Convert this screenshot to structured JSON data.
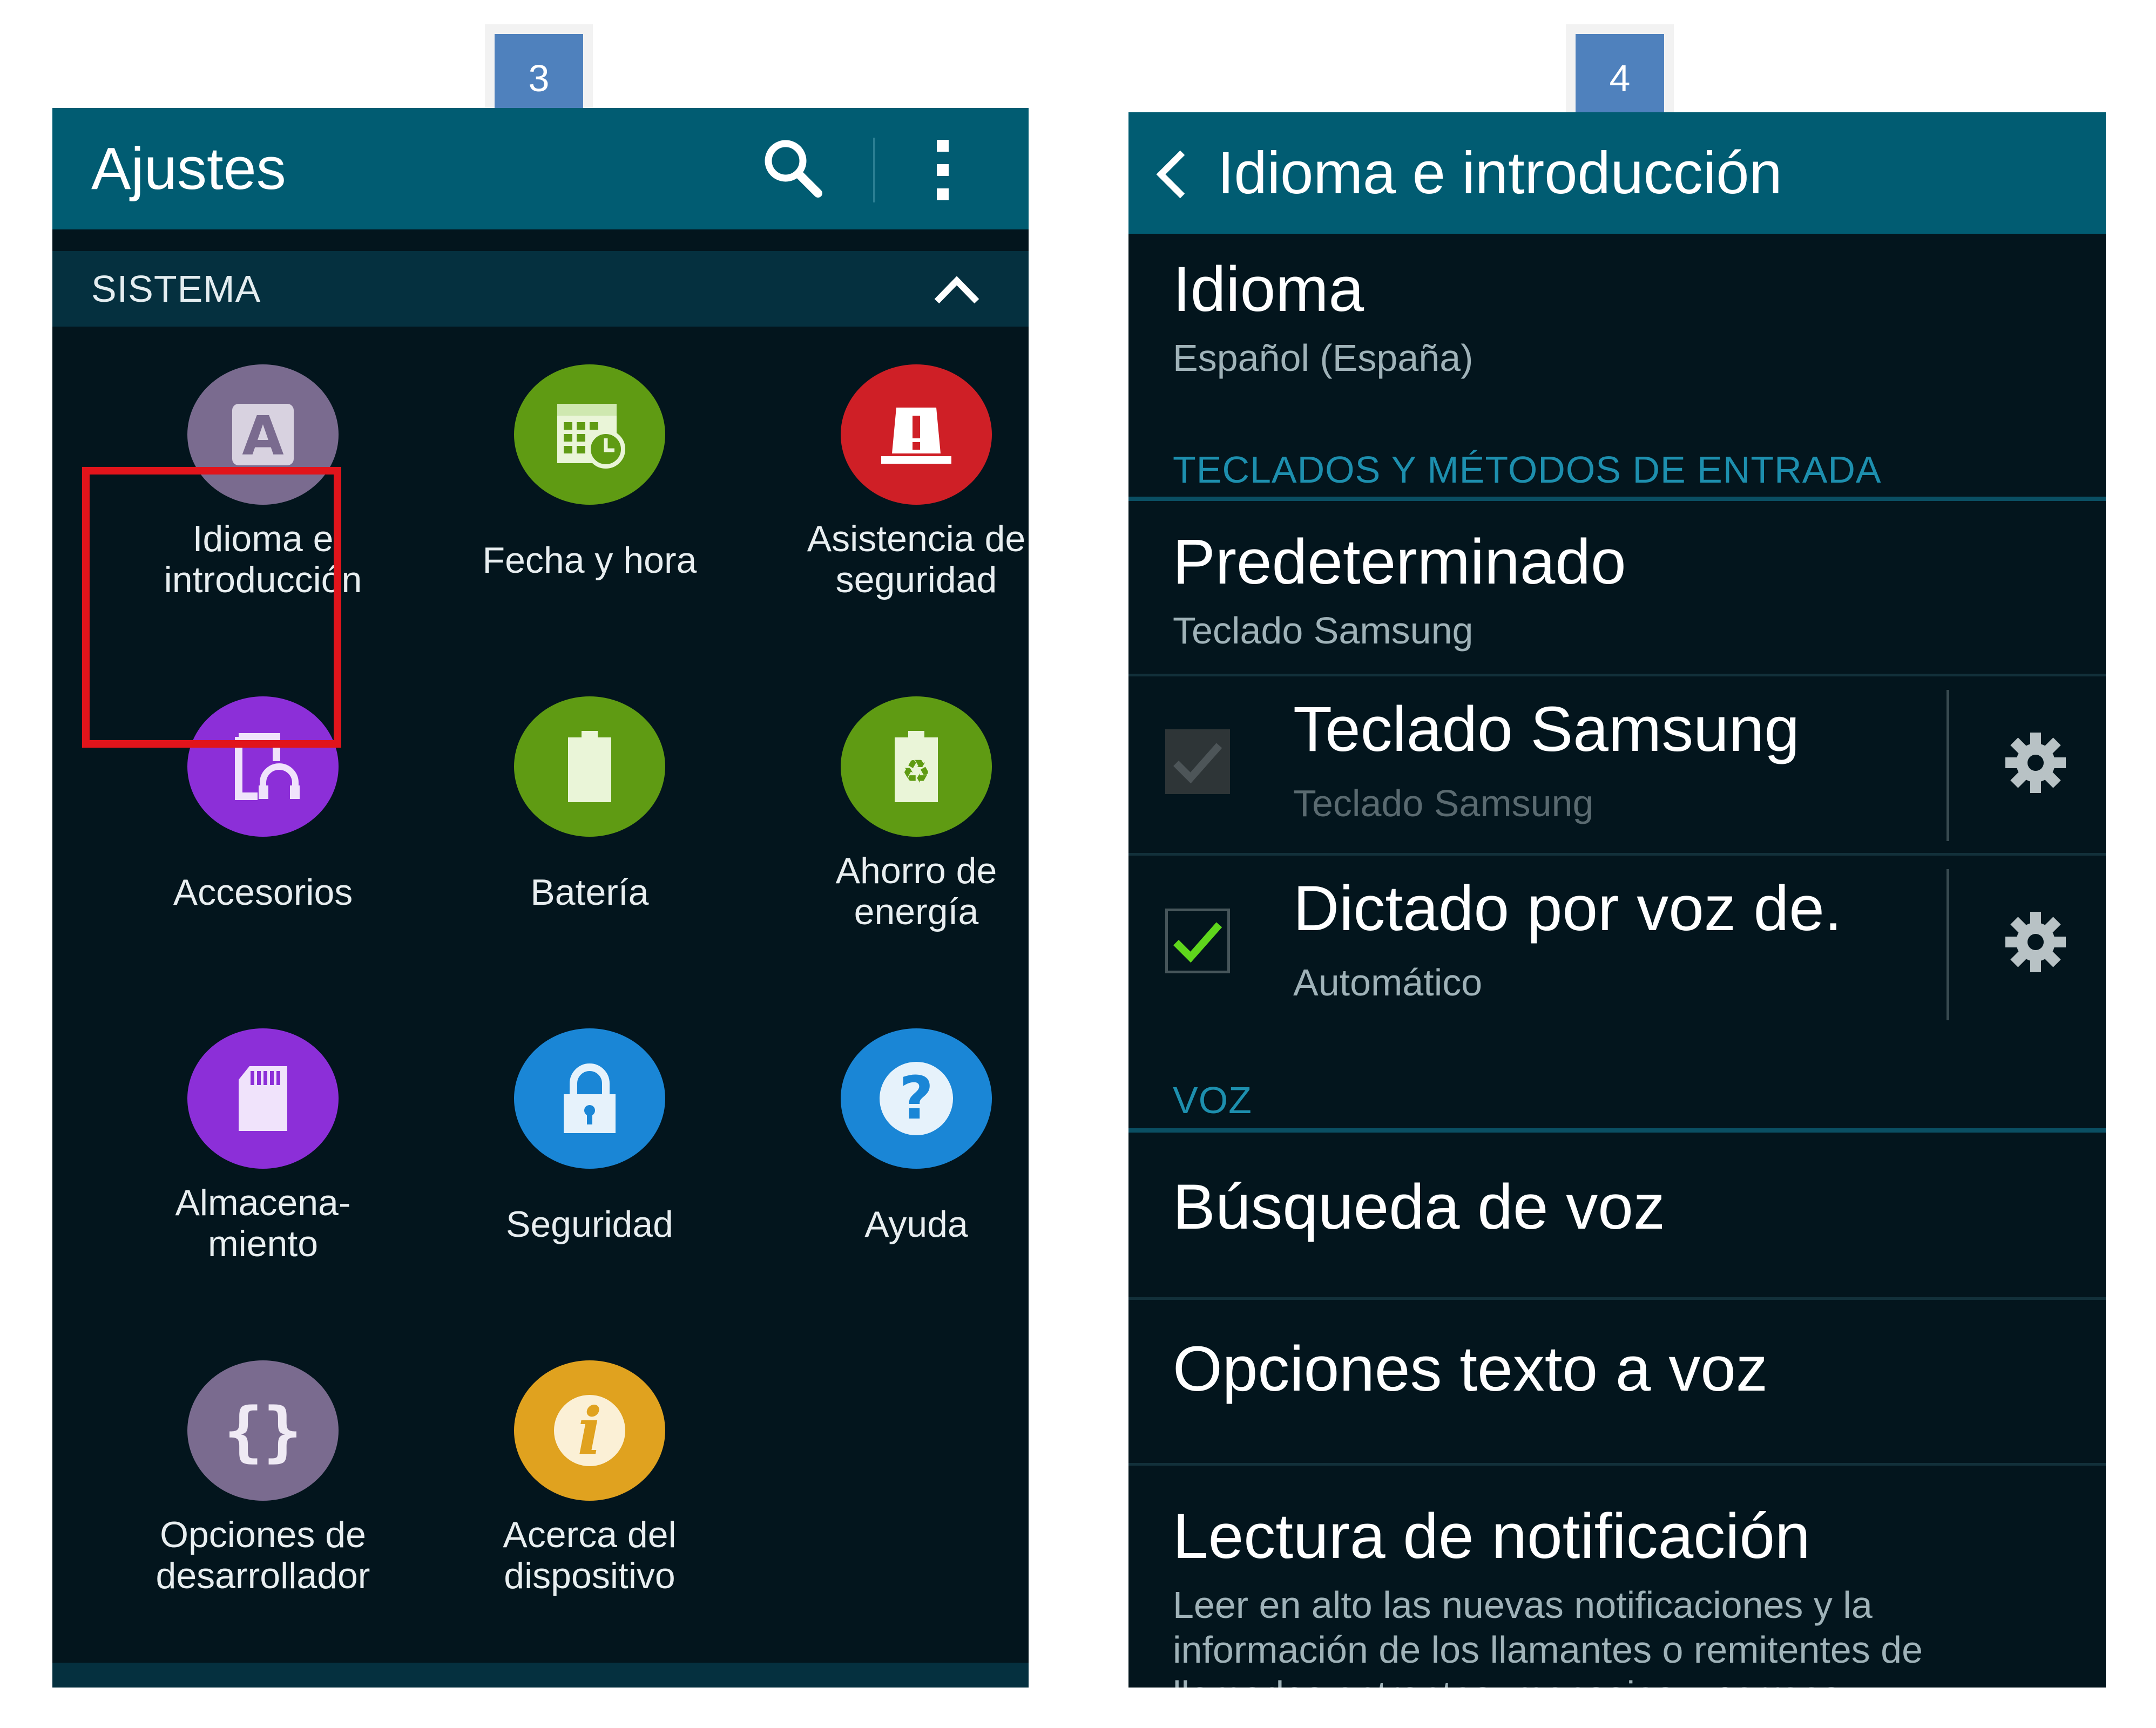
{
  "step_badges": [
    "3",
    "4"
  ],
  "left_screen": {
    "title": "Ajustes",
    "section_label": "SISTEMA",
    "tiles": [
      {
        "label": "Idioma e\nintroducción",
        "color": "#7a6b8f",
        "icon": "language-icon"
      },
      {
        "label": "Fecha y hora",
        "color": "#5f9b13",
        "icon": "calendar-clock-icon"
      },
      {
        "label": "Asistencia de\nseguridad",
        "color": "#cf1f26",
        "icon": "siren-icon"
      },
      {
        "label": "Accesorios",
        "color": "#8c2fd8",
        "icon": "accessories-icon"
      },
      {
        "label": "Batería",
        "color": "#5f9b13",
        "icon": "battery-icon"
      },
      {
        "label": "Ahorro de\nenergía",
        "color": "#5f9b13",
        "icon": "power-saving-icon"
      },
      {
        "label": "Almacena-\nmiento",
        "color": "#8c2fd8",
        "icon": "storage-icon"
      },
      {
        "label": "Seguridad",
        "color": "#1a86d6",
        "icon": "lock-icon"
      },
      {
        "label": "Ayuda",
        "color": "#1a86d6",
        "icon": "help-icon"
      },
      {
        "label": "Opciones de\ndesarrollador",
        "color": "#7a6b8f",
        "icon": "developer-icon"
      },
      {
        "label": "Acerca del\ndispositivo",
        "color": "#e0a21f",
        "icon": "info-icon"
      }
    ]
  },
  "right_screen": {
    "title": "Idioma e introducción",
    "language": {
      "title": "Idioma",
      "value": "Español (España)"
    },
    "keyboards_section": "TECLADOS Y MÉTODOS DE ENTRADA",
    "default": {
      "title": "Predeterminado",
      "value": "Teclado Samsung"
    },
    "samsung_keyboard": {
      "title": "Teclado Samsung",
      "value": "Teclado Samsung",
      "checked": true,
      "enabled": false
    },
    "voice_dictation": {
      "title": "Dictado por voz de.",
      "value": "Automático",
      "checked": true,
      "enabled": true
    },
    "voice_section": "VOZ",
    "voice_search": "Búsqueda de voz",
    "tts_options": "Opciones texto a voz",
    "notification_reading": {
      "title": "Lectura de notificación",
      "desc_line1": "Leer en alto las nuevas notificaciones y la",
      "desc_line2": "información de los llamantes o remitentes de",
      "desc_line3": "llamadas entrantes, mensajes y correos"
    }
  },
  "colors": {
    "appbar": "#015c72",
    "background": "#03151d",
    "section_text": "#1d8fae",
    "highlight": "#e1141b",
    "check": "#5fd61c"
  }
}
